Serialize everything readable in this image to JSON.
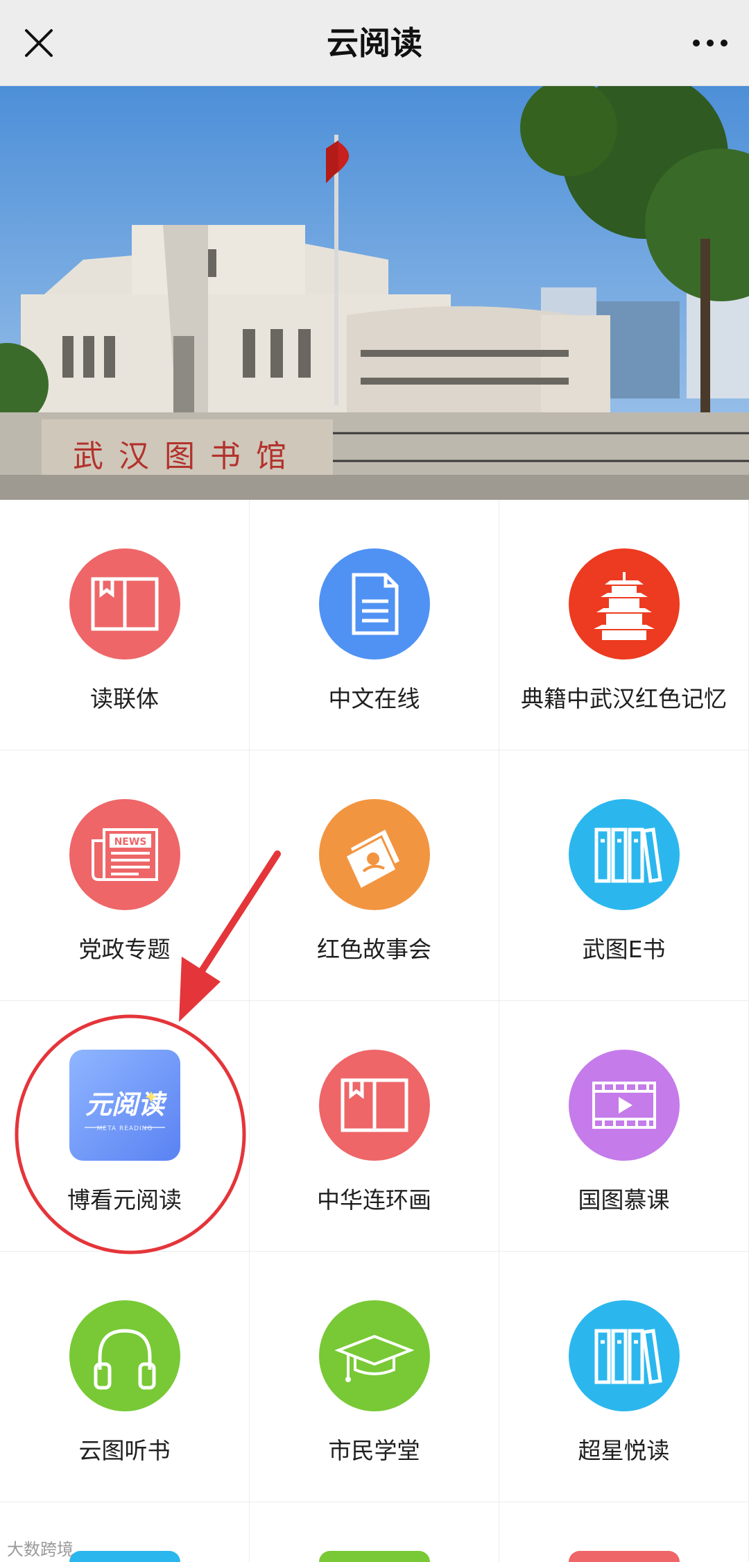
{
  "header": {
    "title": "云阅读",
    "close_icon": "close-icon",
    "more_icon": "more-dots-icon"
  },
  "banner": {
    "sign_text": "武汉图书馆"
  },
  "tiles": [
    {
      "label": "读联体",
      "icon": "open-book-icon",
      "color": "#ee6668"
    },
    {
      "label": "中文在线",
      "icon": "document-icon",
      "color": "#4f92f4"
    },
    {
      "label": "典籍中武汉红色记忆",
      "icon": "yellow-crane-tower-icon",
      "color": "#ec3b20"
    },
    {
      "label": "党政专题",
      "icon": "newspaper-icon",
      "color": "#ee6668"
    },
    {
      "label": "红色故事会",
      "icon": "magazines-icon",
      "color": "#f29540"
    },
    {
      "label": "武图E书",
      "icon": "books-shelf-icon",
      "color": "#2bb7ee"
    },
    {
      "label": "博看元阅读",
      "icon": "meta-reading-app-icon",
      "color": "#5b8ef7",
      "logo_text": "元阅读",
      "logo_sub": "META READING"
    },
    {
      "label": "中华连环画",
      "icon": "open-book-icon",
      "color": "#ee6668"
    },
    {
      "label": "国图慕课",
      "icon": "video-play-icon",
      "color": "#c57bea"
    },
    {
      "label": "云图听书",
      "icon": "headphones-icon",
      "color": "#78c935"
    },
    {
      "label": "市民学堂",
      "icon": "graduation-cap-icon",
      "color": "#78c935"
    },
    {
      "label": "超星悦读",
      "icon": "books-shelf-icon",
      "color": "#2bb7ee"
    }
  ],
  "watermark": "大数跨境"
}
